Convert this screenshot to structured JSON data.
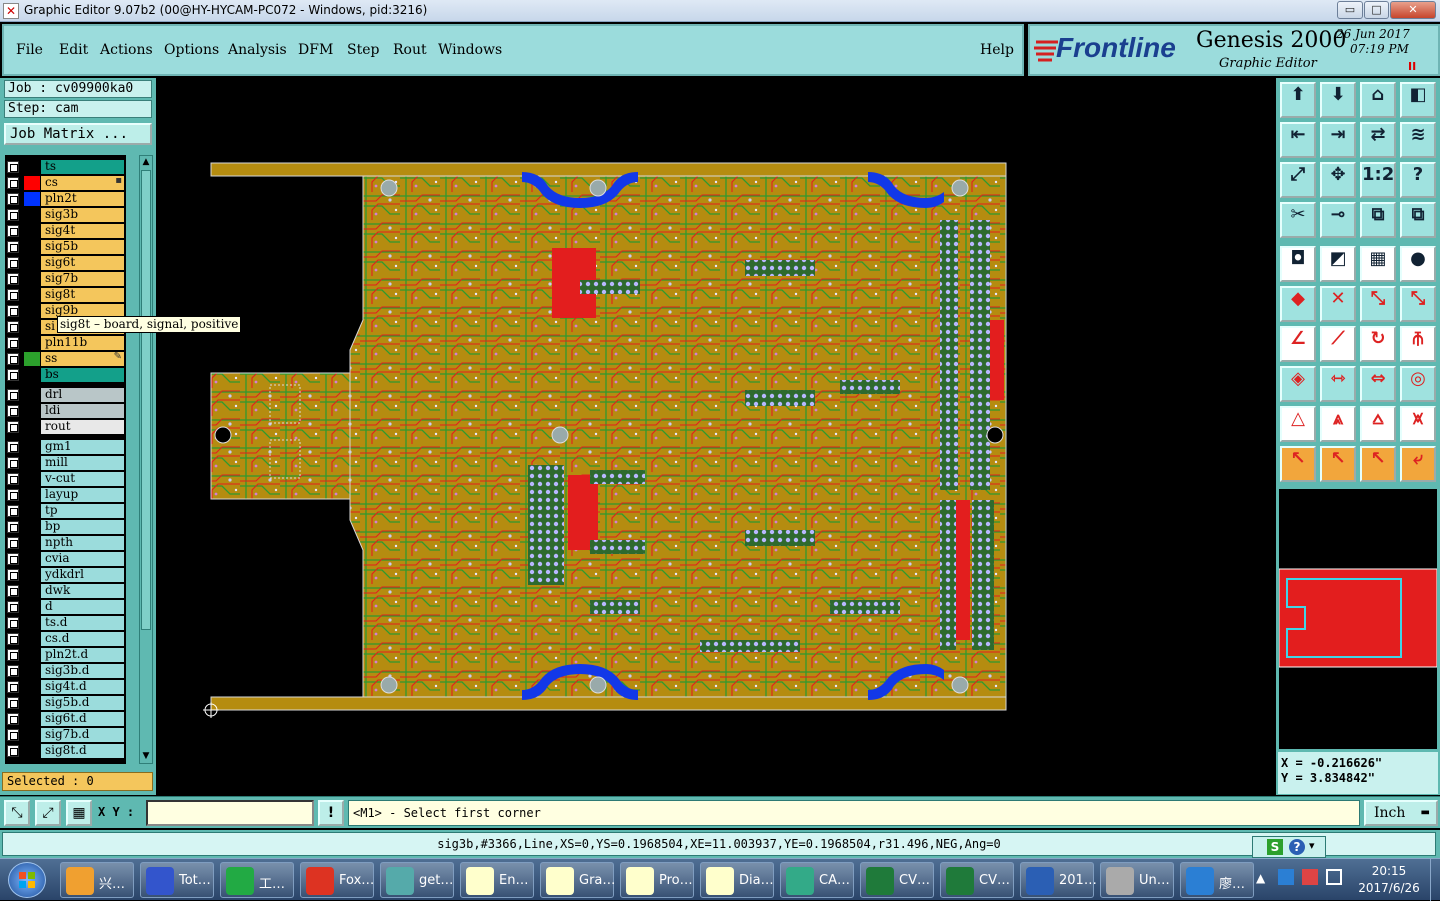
{
  "window": {
    "title": "Graphic Editor 9.07b2 (00@HY-HYCAM-PC072 - Windows, pid:3216)",
    "controls": [
      "▭",
      "□",
      "✕"
    ]
  },
  "menu": {
    "items": [
      "File",
      "Edit",
      "Actions",
      "Options",
      "Analysis",
      "DFM",
      "Step",
      "Rout",
      "Windows"
    ],
    "help": "Help"
  },
  "brand": {
    "logo": "Frontline",
    "product": "Genesis 2000",
    "subtitle": "Graphic Editor",
    "date": "26 Jun 2017",
    "time": "07:19 PM",
    "indicator": "II"
  },
  "job": {
    "job_label": "Job : cv09900ka0",
    "step_label": "Step: cam",
    "matrix_button": "Job Matrix ..."
  },
  "layers": [
    {
      "name": "ts",
      "color": "#13a08a",
      "swatch": "#000000"
    },
    {
      "name": "cs",
      "color": "#f4c65c",
      "swatch": "#ff0000",
      "flag": "▪"
    },
    {
      "name": "pln2t",
      "color": "#f4c65c",
      "swatch": "#0033ff"
    },
    {
      "name": "sig3b",
      "color": "#f4c65c",
      "swatch": "#000000"
    },
    {
      "name": "sig4t",
      "color": "#f4c65c",
      "swatch": "#000000"
    },
    {
      "name": "sig5b",
      "color": "#f4c65c",
      "swatch": "#000000"
    },
    {
      "name": "sig6t",
      "color": "#f4c65c",
      "swatch": "#000000"
    },
    {
      "name": "sig7b",
      "color": "#f4c65c",
      "swatch": "#000000"
    },
    {
      "name": "sig8t",
      "color": "#f4c65c",
      "swatch": "#000000"
    },
    {
      "name": "sig9b",
      "color": "#f4c65c",
      "swatch": "#000000"
    },
    {
      "name": "si",
      "color": "#f4c65c",
      "swatch": "#000000"
    },
    {
      "name": "pln11b",
      "color": "#f4c65c",
      "swatch": "#000000"
    },
    {
      "name": "ss",
      "color": "#f4c65c",
      "swatch": "#2ca02c",
      "flag": "✎"
    },
    {
      "name": "bs",
      "color": "#13a08a",
      "swatch": "#000000"
    },
    {
      "name": "drl",
      "color": "#b9c6c8",
      "swatch": "#000000"
    },
    {
      "name": "ldi",
      "color": "#b9c6c8",
      "swatch": "#000000"
    },
    {
      "name": "rout",
      "color": "#e8e8e8",
      "swatch": "#000000"
    },
    {
      "name": "gm1",
      "color": "#9bdcdc",
      "swatch": "#000000"
    },
    {
      "name": "mill",
      "color": "#9bdcdc",
      "swatch": "#000000"
    },
    {
      "name": "v-cut",
      "color": "#9bdcdc",
      "swatch": "#000000"
    },
    {
      "name": "layup",
      "color": "#9bdcdc",
      "swatch": "#000000"
    },
    {
      "name": "tp",
      "color": "#9bdcdc",
      "swatch": "#000000"
    },
    {
      "name": "bp",
      "color": "#9bdcdc",
      "swatch": "#000000"
    },
    {
      "name": "npth",
      "color": "#9bdcdc",
      "swatch": "#000000"
    },
    {
      "name": "cvia",
      "color": "#9bdcdc",
      "swatch": "#000000"
    },
    {
      "name": "ydkdrl",
      "color": "#9bdcdc",
      "swatch": "#000000"
    },
    {
      "name": "dwk",
      "color": "#9bdcdc",
      "swatch": "#000000"
    },
    {
      "name": "d",
      "color": "#9bdcdc",
      "swatch": "#000000"
    },
    {
      "name": "ts.d",
      "color": "#9bdcdc",
      "swatch": "#000000"
    },
    {
      "name": "cs.d",
      "color": "#9bdcdc",
      "swatch": "#000000"
    },
    {
      "name": "pln2t.d",
      "color": "#9bdcdc",
      "swatch": "#000000"
    },
    {
      "name": "sig3b.d",
      "color": "#9bdcdc",
      "swatch": "#000000"
    },
    {
      "name": "sig4t.d",
      "color": "#9bdcdc",
      "swatch": "#000000"
    },
    {
      "name": "sig5b.d",
      "color": "#9bdcdc",
      "swatch": "#000000"
    },
    {
      "name": "sig6t.d",
      "color": "#9bdcdc",
      "swatch": "#000000"
    },
    {
      "name": "sig7b.d",
      "color": "#9bdcdc",
      "swatch": "#000000"
    },
    {
      "name": "sig8t.d",
      "color": "#9bdcdc",
      "swatch": "#000000"
    }
  ],
  "tooltip": "sig8t – board, signal, positive",
  "selected": "Selected : 0",
  "coords": {
    "x": "X = -0.216626\"",
    "y": "Y = 3.834842\""
  },
  "command": {
    "xy_label": "X Y :",
    "xy_value": "",
    "alert": "!",
    "prompt": "<M1> - Select first corner",
    "units": "Inch",
    "units_arrow": "▬"
  },
  "status": "sig3b,#3366,Line,XS=0,YS=0.1968504,XE=11.003937,YE=0.1968504,r31.496,NEG,Ang=0",
  "taskbar": {
    "items": [
      {
        "label": "兴…",
        "color": "#f0a030"
      },
      {
        "label": "Tot…",
        "color": "#3355cc"
      },
      {
        "label": "工…",
        "color": "#22aa44"
      },
      {
        "label": "Fox…",
        "color": "#dd3322"
      },
      {
        "label": "get…",
        "color": "#55aaaa"
      },
      {
        "label": "En…",
        "color": "#ffffcc"
      },
      {
        "label": "Gra…",
        "color": "#ffffcc"
      },
      {
        "label": "Pro…",
        "color": "#ffffcc"
      },
      {
        "label": "Dia…",
        "color": "#ffffcc"
      },
      {
        "label": "CA…",
        "color": "#33aa88"
      },
      {
        "label": "CV…",
        "color": "#1f7a3a"
      },
      {
        "label": "CV…",
        "color": "#1f7a3a"
      },
      {
        "label": "201…",
        "color": "#2b5fb4"
      },
      {
        "label": "Un…",
        "color": "#aaaaaa"
      },
      {
        "label": "廖…",
        "color": "#2b7fd4"
      }
    ],
    "clock_time": "20:15",
    "clock_date": "2017/6/26"
  }
}
